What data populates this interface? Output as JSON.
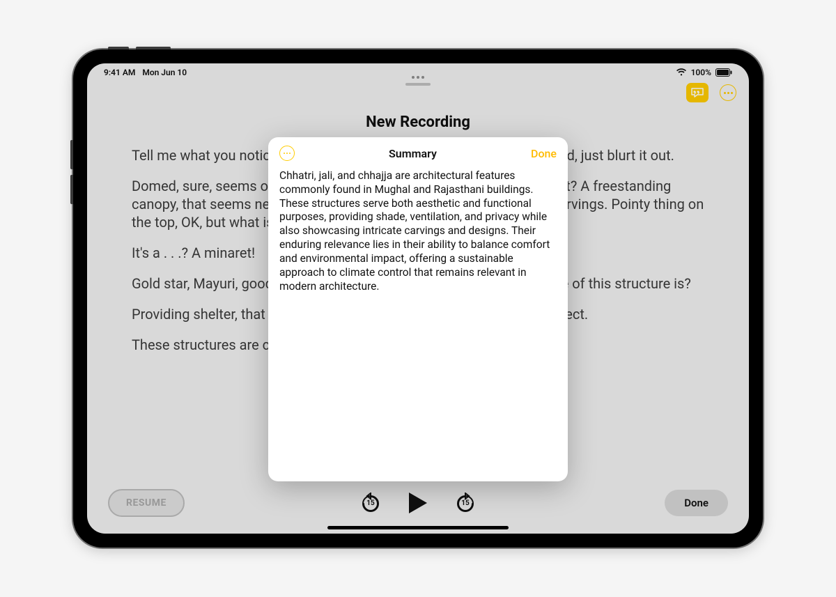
{
  "status": {
    "time": "9:41 AM",
    "date": "Mon Jun 10",
    "battery_pct": "100%"
  },
  "app": {
    "title": "New Recording",
    "resume_label": "RESUME",
    "done_label": "Done",
    "skip_seconds": "15"
  },
  "transcript": {
    "p1": "Tell me what you notice about this structure. No need to raise your hand, just blurt it out.",
    "p2": "Domed, sure, seems of a pattern for all the places we've looked at, right? A freestanding canopy, that seems new for us. Columns, and ornamentation of fine carvings. Pointy thing on the top, OK, but what is that pointy thing called?",
    "p3": "It's a . . .? A minaret!",
    "p4": "Gold star, Mayuri, good memory. Now, what do we imagine the purpose of this structure is?",
    "p5": "Providing shelter, that makes sense. Oh, Marcus, you're absolutely correct.",
    "p6": "These structures are called . . ."
  },
  "modal": {
    "title": "Summary",
    "done_label": "Done",
    "body": "Chhatri, jali, and chhajja are architectural features commonly found in Mughal and Rajasthani buildings. These structures serve both aesthetic and functional purposes, providing shade, ventilation, and privacy while also showcasing intricate carvings and designs. Their enduring relevance lies in their ability to balance comfort and environmental impact, offering a sustainable approach to climate control that remains relevant in modern architecture."
  }
}
